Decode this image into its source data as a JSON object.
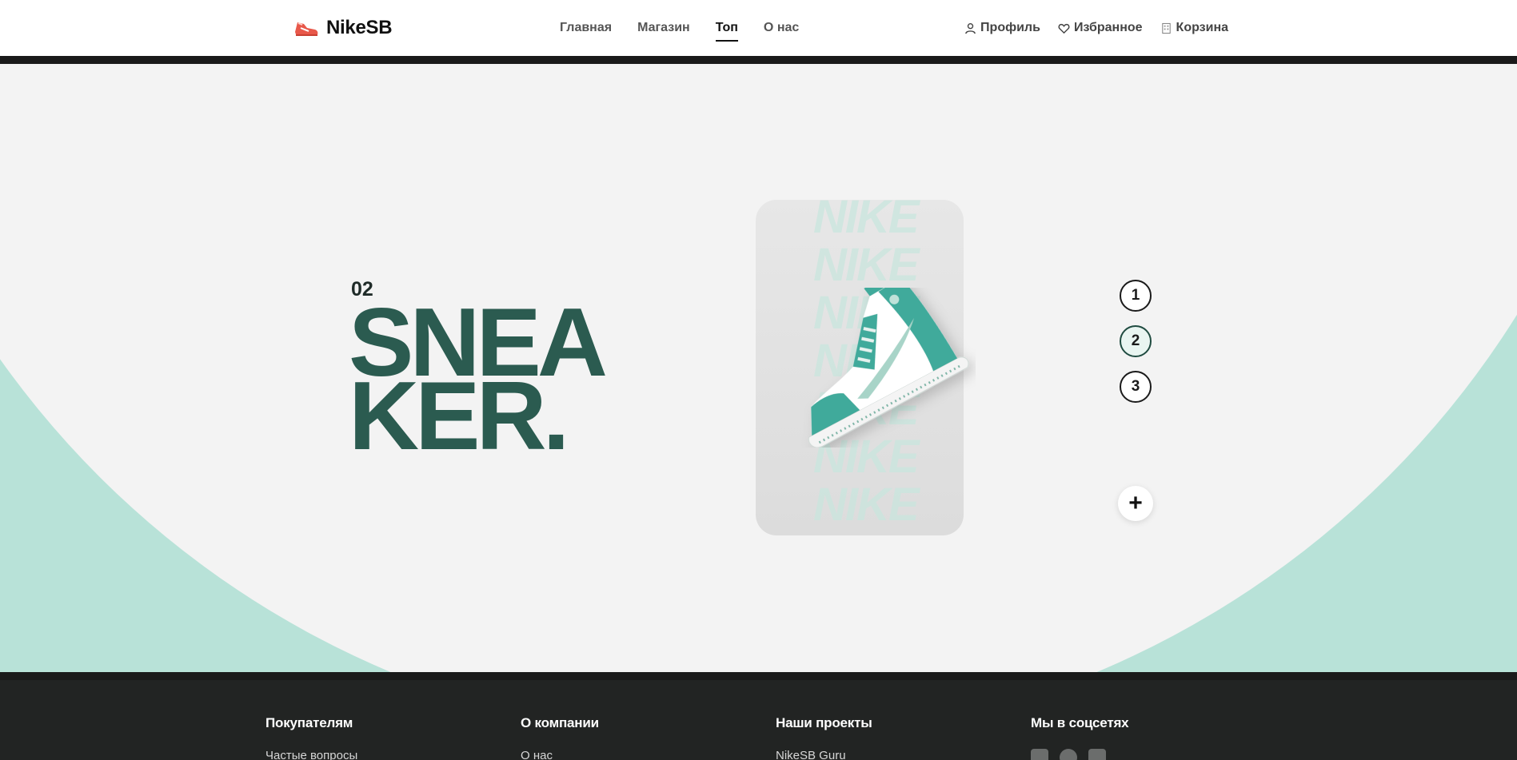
{
  "header": {
    "brand": "NikeSB",
    "nav": [
      {
        "label": "Главная",
        "active": false
      },
      {
        "label": "Магазин",
        "active": false
      },
      {
        "label": "Топ",
        "active": true
      },
      {
        "label": "О нас",
        "active": false
      }
    ],
    "user_links": [
      {
        "label": "Профиль",
        "icon": "user-icon"
      },
      {
        "label": "Избранное",
        "icon": "heart-icon"
      },
      {
        "label": "Корзина",
        "icon": "cart-icon"
      }
    ]
  },
  "hero": {
    "slide_number": "02",
    "title_line1": "SNEA",
    "title_line2": "KER.",
    "background_word": "NIKE",
    "slides": [
      "1",
      "2",
      "3"
    ],
    "active_slide": "2",
    "plus_label": "+"
  },
  "footer": {
    "columns": [
      {
        "title": "Покупателям",
        "links": [
          "Частые вопросы"
        ]
      },
      {
        "title": "О компании",
        "links": [
          "О нас"
        ]
      },
      {
        "title": "Наши проекты",
        "links": [
          "NikeSB Guru"
        ]
      },
      {
        "title": "Мы в соцсетях",
        "links": []
      }
    ]
  },
  "colors": {
    "accent_dark_green": "#2b5b50",
    "mint": "#b8e2d8",
    "hero_light": "#f3f3f3",
    "footer_bg": "#222423"
  }
}
